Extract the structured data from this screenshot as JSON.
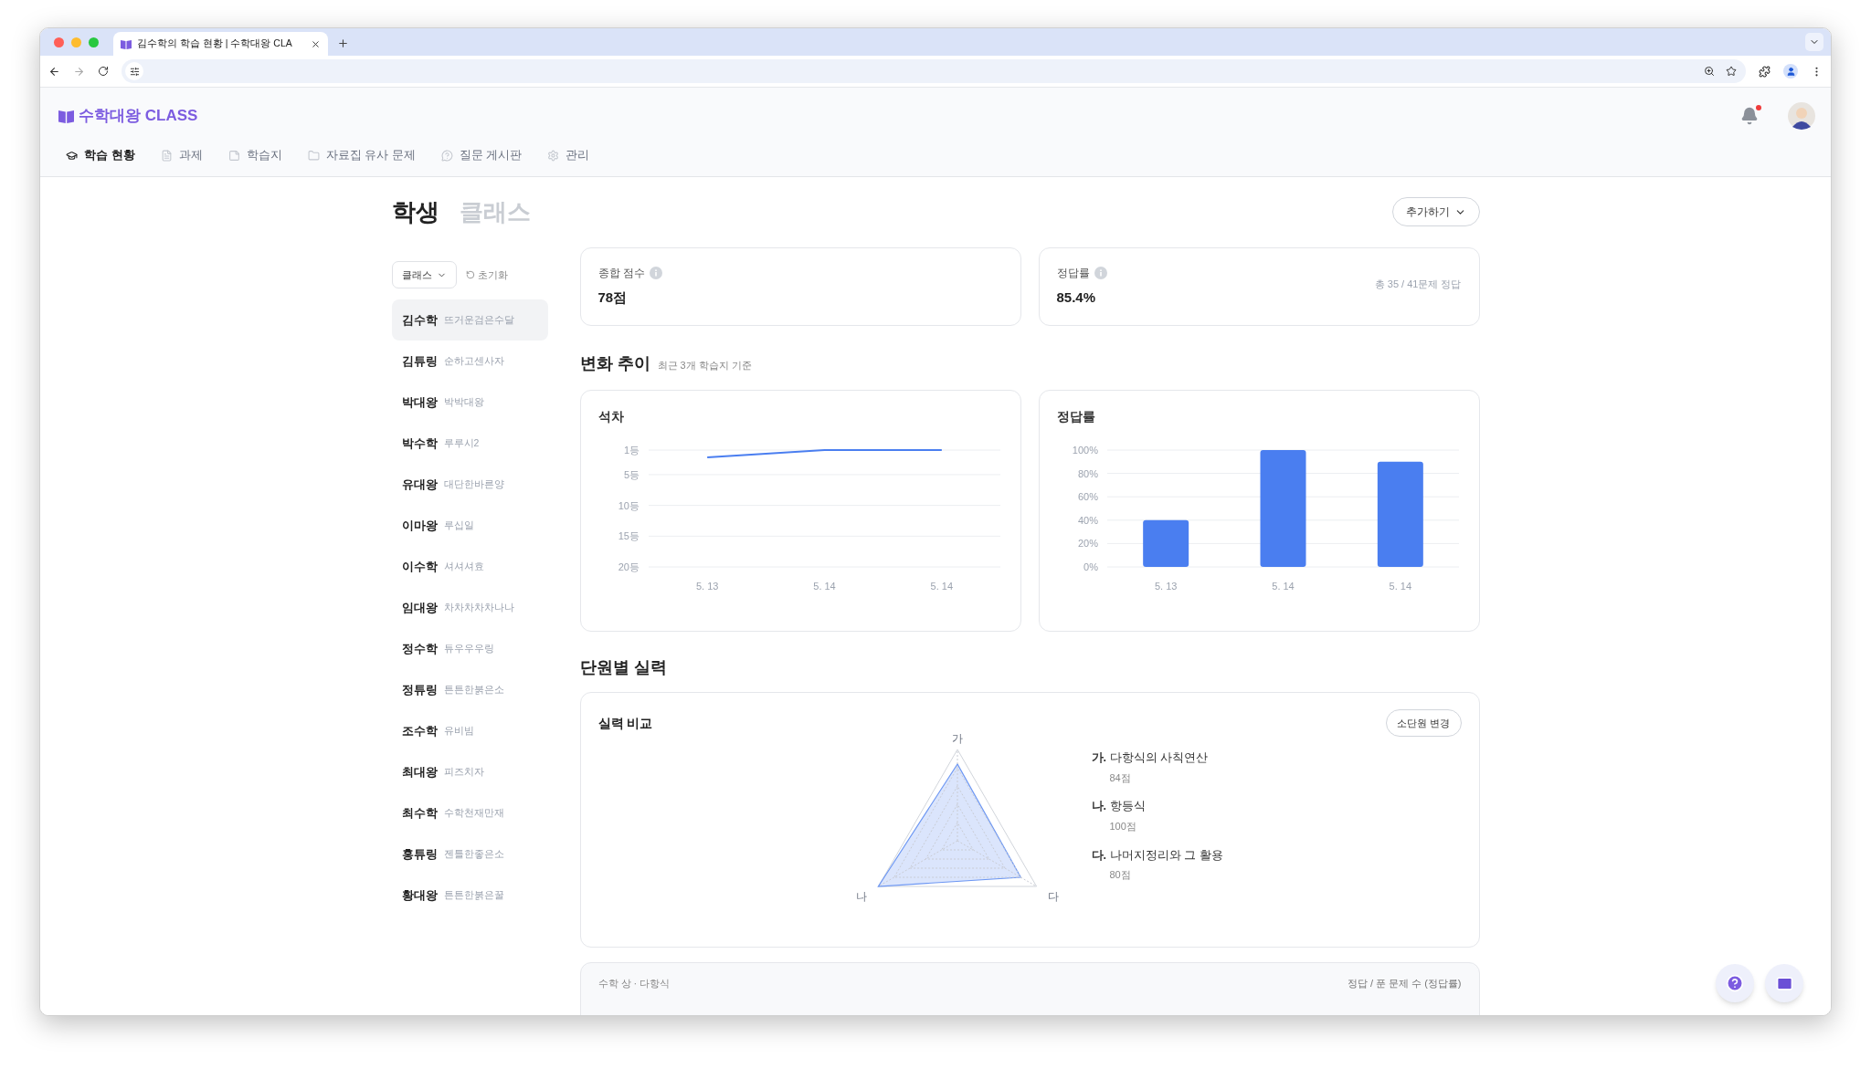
{
  "browser": {
    "tab_title": "김수학의 학습 현황 | 수학대왕 CLA"
  },
  "app": {
    "logo": "수학대왕 CLASS",
    "unread": true,
    "nav": [
      {
        "label": "학습 현황",
        "selected": true
      },
      {
        "label": "과제",
        "selected": false
      },
      {
        "label": "학습지",
        "selected": false
      },
      {
        "label": "자료집 유사 문제",
        "selected": false
      },
      {
        "label": "질문 게시판",
        "selected": false
      },
      {
        "label": "관리",
        "selected": false
      }
    ]
  },
  "view_tabs": [
    {
      "label": "학생",
      "selected": true
    },
    {
      "label": "클래스",
      "selected": false
    }
  ],
  "add_button": "추가하기",
  "filter": {
    "class_label": "클래스",
    "reset": "초기화"
  },
  "students": [
    {
      "name": "김수학",
      "nickname": "뜨거운검은수달",
      "selected": true
    },
    {
      "name": "김튜링",
      "nickname": "순하고센사자",
      "selected": false
    },
    {
      "name": "박대왕",
      "nickname": "박박대왕",
      "selected": false
    },
    {
      "name": "박수학",
      "nickname": "루루시2",
      "selected": false
    },
    {
      "name": "유대왕",
      "nickname": "대단한바른양",
      "selected": false
    },
    {
      "name": "이마왕",
      "nickname": "루십일",
      "selected": false
    },
    {
      "name": "이수학",
      "nickname": "셔셔셔효",
      "selected": false
    },
    {
      "name": "임대왕",
      "nickname": "차차차차차나나",
      "selected": false
    },
    {
      "name": "정수학",
      "nickname": "튜우우우링",
      "selected": false
    },
    {
      "name": "정튜링",
      "nickname": "튼튼한붉은소",
      "selected": false
    },
    {
      "name": "조수학",
      "nickname": "유비빔",
      "selected": false
    },
    {
      "name": "최대왕",
      "nickname": "피즈치자",
      "selected": false
    },
    {
      "name": "최수학",
      "nickname": "수학천재만재",
      "selected": false
    },
    {
      "name": "홍튜링",
      "nickname": "젠틀한좋은소",
      "selected": false
    },
    {
      "name": "황대왕",
      "nickname": "튼튼한붉은꿀",
      "selected": false
    }
  ],
  "summary": [
    {
      "title": "종합 점수",
      "value": "78점"
    },
    {
      "title": "정답률",
      "value": "85.4%",
      "note": "총 35 / 41문제 정답"
    }
  ],
  "trend": {
    "title": "변화 추이",
    "subtitle": "최근 3개 학습지 기준",
    "charts": [
      {
        "title": "석차",
        "chart_data": {
          "type": "line",
          "categories": [
            "5. 13",
            "5. 14",
            "5. 14"
          ],
          "ylim": [
            20,
            1
          ],
          "grid": true,
          "yticks": [
            {
              "value": 1,
              "label": "1등"
            },
            {
              "value": 5,
              "label": "5등"
            },
            {
              "value": 10,
              "label": "10등"
            },
            {
              "value": 15,
              "label": "15등"
            },
            {
              "value": 20,
              "label": "20등"
            }
          ],
          "series": [
            {
              "color": "#4a7ef0",
              "values": [
                2.2,
                1,
                1
              ]
            }
          ]
        }
      },
      {
        "title": "정답률",
        "chart_data": {
          "type": "bar",
          "categories": [
            "5. 13",
            "5. 14",
            "5. 14"
          ],
          "ylim": [
            0,
            100
          ],
          "grid": true,
          "yticks": [
            {
              "value": 0,
              "label": "0%"
            },
            {
              "value": 20,
              "label": "20%"
            },
            {
              "value": 40,
              "label": "40%"
            },
            {
              "value": 60,
              "label": "60%"
            },
            {
              "value": 80,
              "label": "80%"
            },
            {
              "value": 100,
              "label": "100%"
            }
          ],
          "series": [
            {
              "color": "#4a7ef0",
              "values": [
                40,
                100,
                90
              ]
            }
          ]
        }
      }
    ]
  },
  "units": {
    "title": "단원별 실력",
    "card_title": "실력 비교",
    "button": "소단원 변경",
    "items": [
      {
        "axis": "가",
        "prefix": "가.",
        "name": "다항식의 사칙연산",
        "score": "84점"
      },
      {
        "axis": "나",
        "prefix": "나.",
        "name": "항등식",
        "score": "100점"
      },
      {
        "axis": "다",
        "prefix": "다.",
        "name": "나머지정리와 그 활용",
        "score": "80점"
      }
    ]
  },
  "detail": {
    "path": "수학 상 · 다항식",
    "legend": "정답 / 푼 문제 수 (정답률)"
  }
}
